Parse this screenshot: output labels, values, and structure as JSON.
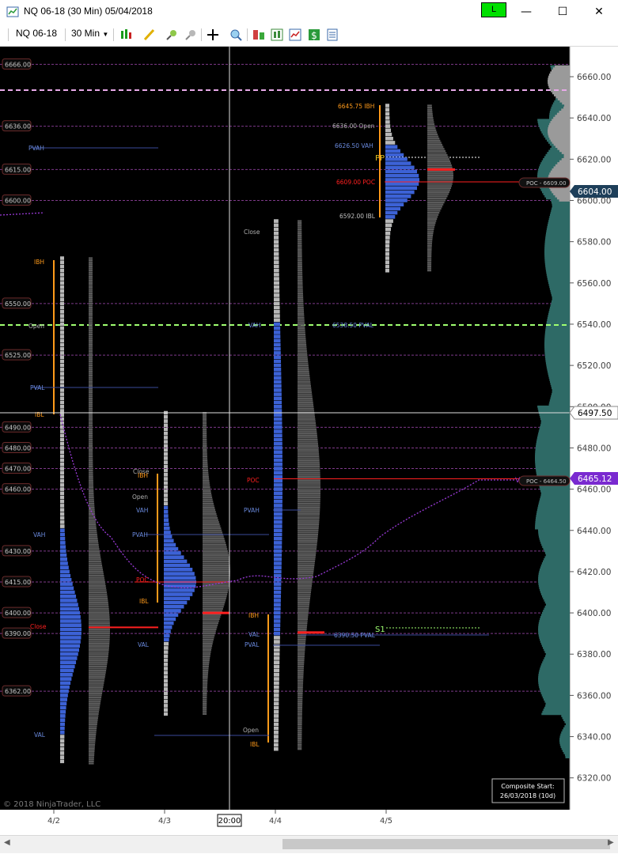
{
  "window": {
    "title": "NQ 06-18 (30 Min)  05/04/2018",
    "connection_status": "L",
    "connection_color": "#00e000",
    "controls": {
      "minimize": "—",
      "maximize": "☐",
      "close": "✕"
    }
  },
  "toolbar": {
    "instrument": "NQ 06-18",
    "interval": "30 Min",
    "icons": [
      "chart-style-icon",
      "drawing-tool-icon",
      "zoom-in-icon",
      "zoom-out-icon",
      "crosshair-icon",
      "data-box-icon",
      "strategies-icon",
      "indicators-icon",
      "performance-icon",
      "dollar-icon",
      "properties-icon"
    ]
  },
  "colors": {
    "background": "#000000",
    "profile_value_area": "#3c62d6",
    "profile_outside": "#b8b8b8",
    "ghost_profile": "#5a5a5a",
    "poc": "#ff2020",
    "ib_bar": "#ff9a1a",
    "level_line": "#7e3a8a",
    "composite": "#2e6a66",
    "pp_line": "#e7a9e8",
    "s1_line": "#9fff70",
    "vwap": "#9a3ad8"
  },
  "price_axis": {
    "ticks": [
      "6660.00",
      "6640.00",
      "6620.00",
      "6600.00",
      "6580.00",
      "6560.00",
      "6540.00",
      "6520.00",
      "6500.00",
      "6480.00",
      "6460.00",
      "6440.00",
      "6420.00",
      "6400.00",
      "6380.00",
      "6360.00",
      "6340.00",
      "6320.00"
    ],
    "current_price": "6604.00",
    "crosshair_price": "6497.50",
    "vwap_price": "6465.12"
  },
  "left_levels": [
    "6666.00",
    "6636.00",
    "6615.00",
    "6600.00",
    "6550.00",
    "6525.00",
    "6490.00",
    "6480.00",
    "6470.00",
    "6460.00",
    "6430.00",
    "6415.00",
    "6400.00",
    "6390.00",
    "6362.00"
  ],
  "time_axis": {
    "labels": [
      "4/2",
      "4/3",
      "4/4",
      "4/5"
    ],
    "crosshair_time": "20:00"
  },
  "sessions": [
    {
      "date": "4/2",
      "labels": {
        "ibh": "IBH",
        "ibl": "IBL",
        "open": "Open",
        "pvah": "PVAH",
        "pval": "PVAL",
        "vah": "VAH",
        "val": "VAL",
        "close": "Close"
      }
    },
    {
      "date": "4/3",
      "labels": {
        "close": "Close",
        "ibh": "IBH",
        "open": "Open",
        "vah": "VAH",
        "pvah": "PVAH",
        "poc": "POC",
        "ibl": "IBL",
        "val": "VAL"
      }
    },
    {
      "date": "4/4",
      "labels": {
        "close": "Close",
        "vah": "VAH",
        "poc": "POC",
        "pvah": "PVAH",
        "ibh": "IBH",
        "val": "VAL",
        "pval": "PVAL",
        "open": "Open",
        "ibl": "IBL"
      }
    },
    {
      "date": "4/5",
      "labels": {
        "ibh": "6645.75 IBH",
        "open": "6636.00 Open",
        "vah": "6626.50 VAH",
        "poc": "6609.00 POC",
        "ibl": "6592.00 IBL",
        "pp": "PP"
      }
    }
  ],
  "annotations": {
    "pval_4_4": "6390.50 PVAL",
    "pval_4_5": "6538.50 PVAL",
    "s1": "S1",
    "poc_tag_1": "POC - 6609.00",
    "poc_tag_2": "POC - 6464.50",
    "vwap_marker": "V"
  },
  "composite_box": {
    "line1": "Composite Start:",
    "line2": "26/03/2018 (10d)"
  },
  "copyright": "© 2018 NinjaTrader, LLC"
}
